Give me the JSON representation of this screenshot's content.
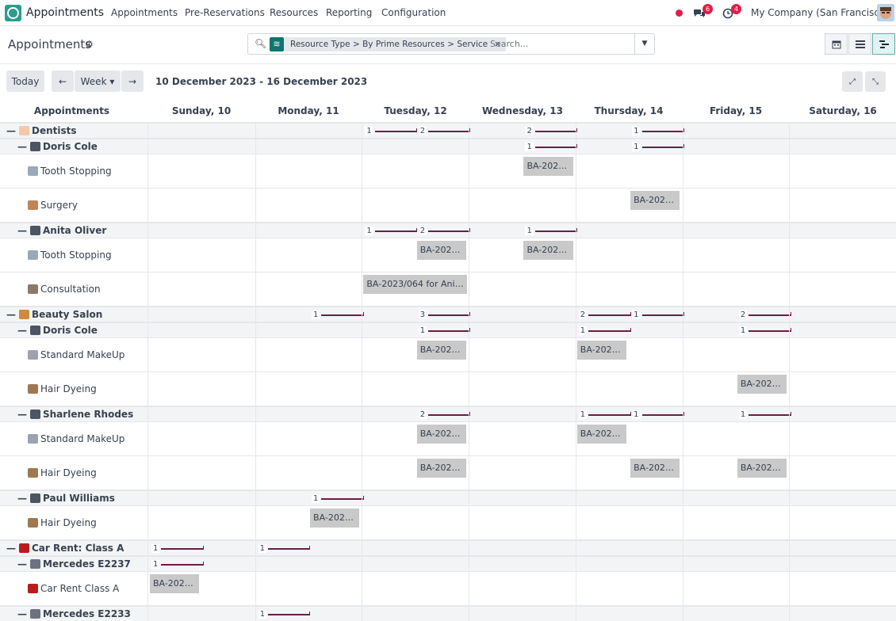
{
  "navbar": {
    "app_name": "Appointments",
    "menu": [
      "Appointments",
      "Pre-Reservations",
      "Resources",
      "Reporting",
      "Configuration"
    ],
    "messages_badge": "6",
    "activities_badge": "4",
    "company": "My Company (San Francisco)"
  },
  "control_panel": {
    "title": "Appointments",
    "search_facet": "Resource Type > By Prime Resources > Service",
    "search_placeholder": "Search..."
  },
  "toolbar": {
    "today_label": "Today",
    "prev_label": "←",
    "scale_label": "Week ▾",
    "next_label": "→",
    "date_range": "10 December 2023 - 16 December 2023"
  },
  "gantt": {
    "header_title": "Appointments",
    "days": [
      "Sunday, 10",
      "Monday, 11",
      "Tuesday, 12",
      "Wednesday, 13",
      "Thursday, 14",
      "Friday, 15",
      "Saturday, 16"
    ],
    "rows": [
      {
        "kind": "group",
        "level": 0,
        "label": "Dentists",
        "icon": "tooth-icon",
        "counts": [
          {
            "day": 2,
            "n": "1"
          },
          {
            "day": 2.5,
            "n": "2"
          },
          {
            "day": 3.5,
            "n": "2"
          },
          {
            "day": 4.5,
            "n": "1"
          }
        ]
      },
      {
        "kind": "group",
        "level": 1,
        "label": "Doris Cole",
        "icon": "person-icon",
        "counts": [
          {
            "day": 3.5,
            "n": "1"
          },
          {
            "day": 4.5,
            "n": "1"
          }
        ]
      },
      {
        "kind": "leaf",
        "label": "Tooth Stopping",
        "icon": "dental-chair-icon",
        "pills": [
          {
            "day": 3.5,
            "text": "BA-2023..."
          }
        ]
      },
      {
        "kind": "leaf",
        "label": "Surgery",
        "icon": "surgery-icon",
        "pills": [
          {
            "day": 4.5,
            "text": "BA-2023..."
          }
        ]
      },
      {
        "kind": "group",
        "level": 1,
        "label": "Anita Oliver",
        "icon": "person-icon",
        "counts": [
          {
            "day": 2,
            "n": "1"
          },
          {
            "day": 2.5,
            "n": "2"
          },
          {
            "day": 3.5,
            "n": "1"
          }
        ]
      },
      {
        "kind": "leaf",
        "label": "Tooth Stopping",
        "icon": "dental-chair-icon",
        "pills": [
          {
            "day": 2.5,
            "text": "BA-2023..."
          },
          {
            "day": 3.5,
            "text": "BA-2023..."
          }
        ]
      },
      {
        "kind": "leaf",
        "label": "Consultation",
        "icon": "consultation-icon",
        "pills": [
          {
            "day": 2,
            "text": "BA-2023/064 for Anit...",
            "wide": true
          }
        ]
      },
      {
        "kind": "group",
        "level": 0,
        "label": "Beauty Salon",
        "icon": "salon-icon",
        "counts": [
          {
            "day": 1.5,
            "n": "1"
          },
          {
            "day": 2.5,
            "n": "3"
          },
          {
            "day": 4,
            "n": "2"
          },
          {
            "day": 4.5,
            "n": "1"
          },
          {
            "day": 5.5,
            "n": "2"
          }
        ]
      },
      {
        "kind": "group",
        "level": 1,
        "label": "Doris Cole",
        "icon": "person-icon",
        "counts": [
          {
            "day": 2.5,
            "n": "1"
          },
          {
            "day": 4,
            "n": "1"
          },
          {
            "day": 5.5,
            "n": "1"
          }
        ]
      },
      {
        "kind": "leaf",
        "label": "Standard MakeUp",
        "icon": "makeup-icon",
        "pills": [
          {
            "day": 2.5,
            "text": "BA-2023..."
          },
          {
            "day": 4,
            "text": "BA-2023..."
          }
        ]
      },
      {
        "kind": "leaf",
        "label": "Hair Dyeing",
        "icon": "hair-icon",
        "pills": [
          {
            "day": 5.5,
            "text": "BA-2023..."
          }
        ]
      },
      {
        "kind": "group",
        "level": 1,
        "label": "Sharlene Rhodes",
        "icon": "person-icon",
        "counts": [
          {
            "day": 2.5,
            "n": "2"
          },
          {
            "day": 4,
            "n": "1"
          },
          {
            "day": 4.5,
            "n": "1"
          },
          {
            "day": 5.5,
            "n": "1"
          }
        ]
      },
      {
        "kind": "leaf",
        "label": "Standard MakeUp",
        "icon": "makeup-icon",
        "pills": [
          {
            "day": 2.5,
            "text": "BA-2023..."
          },
          {
            "day": 4,
            "text": "BA-2023..."
          }
        ]
      },
      {
        "kind": "leaf",
        "label": "Hair Dyeing",
        "icon": "hair-icon",
        "pills": [
          {
            "day": 2.5,
            "text": "BA-2023..."
          },
          {
            "day": 4.5,
            "text": "BA-2023..."
          },
          {
            "day": 5.5,
            "text": "BA-2023..."
          }
        ]
      },
      {
        "kind": "group",
        "level": 1,
        "label": "Paul Williams",
        "icon": "person-icon",
        "counts": [
          {
            "day": 1.5,
            "n": "1"
          }
        ]
      },
      {
        "kind": "leaf",
        "label": "Hair Dyeing",
        "icon": "hair-icon",
        "pills": [
          {
            "day": 1.5,
            "text": "BA-2023..."
          }
        ]
      },
      {
        "kind": "group",
        "level": 0,
        "label": "Car Rent: Class A",
        "icon": "car-icon",
        "counts": [
          {
            "day": 0,
            "n": "1"
          },
          {
            "day": 1,
            "n": "1"
          }
        ]
      },
      {
        "kind": "group",
        "level": 1,
        "label": "Mercedes E2237",
        "icon": "vehicle-icon",
        "counts": [
          {
            "day": 0,
            "n": "1"
          }
        ]
      },
      {
        "kind": "leaf",
        "label": "Car Rent Class A",
        "icon": "car-icon",
        "pills": [
          {
            "day": 0,
            "text": "BA-2023..."
          }
        ]
      },
      {
        "kind": "group",
        "level": 1,
        "label": "Mercedes E2233",
        "icon": "vehicle-icon",
        "counts": [
          {
            "day": 1,
            "n": "1"
          }
        ]
      }
    ]
  },
  "colors": {
    "brand": "#2a9d8f",
    "count_bar": "#6b1d45",
    "pill": "#c9c9c9",
    "badge": "#e11d48"
  }
}
